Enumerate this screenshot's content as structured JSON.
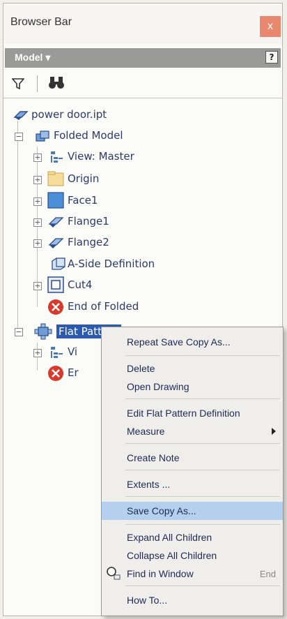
{
  "window": {
    "title": "Browser Bar",
    "close_label": "x"
  },
  "model_bar": {
    "label": "Model ▾",
    "help_label": "?"
  },
  "tree": {
    "root": "power door.ipt",
    "folded_model": "Folded Model",
    "view_master": "View: Master",
    "origin": "Origin",
    "face1": "Face1",
    "flange1": "Flange1",
    "flange2": "Flange2",
    "aside": "A-Side Definition",
    "cut4": "Cut4",
    "end_folded": "End of Folded",
    "flat_pattern": "Flat Pattern",
    "view_partial": "Vi",
    "end_partial": "Er"
  },
  "context_menu": {
    "repeat": "Repeat Save Copy As...",
    "delete": "Delete",
    "open_drawing": "Open Drawing",
    "edit_flat": "Edit Flat Pattern Definition",
    "measure": "Measure",
    "create_note": "Create Note",
    "extents": "Extents ...",
    "save_copy": "Save Copy As...",
    "expand_all": "Expand All Children",
    "collapse_all": "Collapse All Children",
    "find_window": "Find in Window",
    "find_shortcut": "End",
    "how_to": "How To..."
  },
  "colors": {
    "selection": "#2b5bb0",
    "menu_highlight": "#b4d0ee",
    "model_bar": "#9a9a98"
  }
}
